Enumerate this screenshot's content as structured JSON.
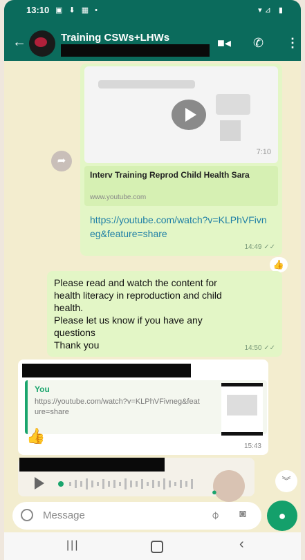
{
  "status_bar": {
    "time": "13:10",
    "left_icons": "▣ ⬇ ▦ •",
    "right_icons": "▾⊿ ▮"
  },
  "header": {
    "title": "Training CSWs+LHWs",
    "video_icon": "videocam-icon",
    "call_icon": "phone-icon",
    "menu_icon": "more-vert-icon"
  },
  "messages": {
    "link_message": {
      "preview_duration": "7:10",
      "link_title": "Interv Training Reprod Child Health Sara",
      "link_domain": "www.youtube.com",
      "url": "https://youtube.com/watch?v=KLPhVFivneg&feature=share",
      "time": "14:49 ✓✓"
    },
    "reaction": "👍",
    "text_message": {
      "lines": [
        "Please read and watch the content for",
        "health literacy in reproduction and child",
        "health.",
        "Please let us know if you have any",
        "questions",
        "Thank you"
      ],
      "time": "14:50 ✓✓"
    },
    "reply_message": {
      "quote_author": "You",
      "quote_text": "https://youtube.com/watch?v=KLPhVFivneg&feature=share",
      "emoji": "👍",
      "time": "15:43"
    }
  },
  "input": {
    "placeholder": "Message"
  },
  "nav": {
    "recents": "|||",
    "back": "‹"
  },
  "colors": {
    "header": "#0b6b5c",
    "outgoing_bubble": "#e3f6c6",
    "accent": "#14a06b",
    "link": "#1e7fa5"
  }
}
